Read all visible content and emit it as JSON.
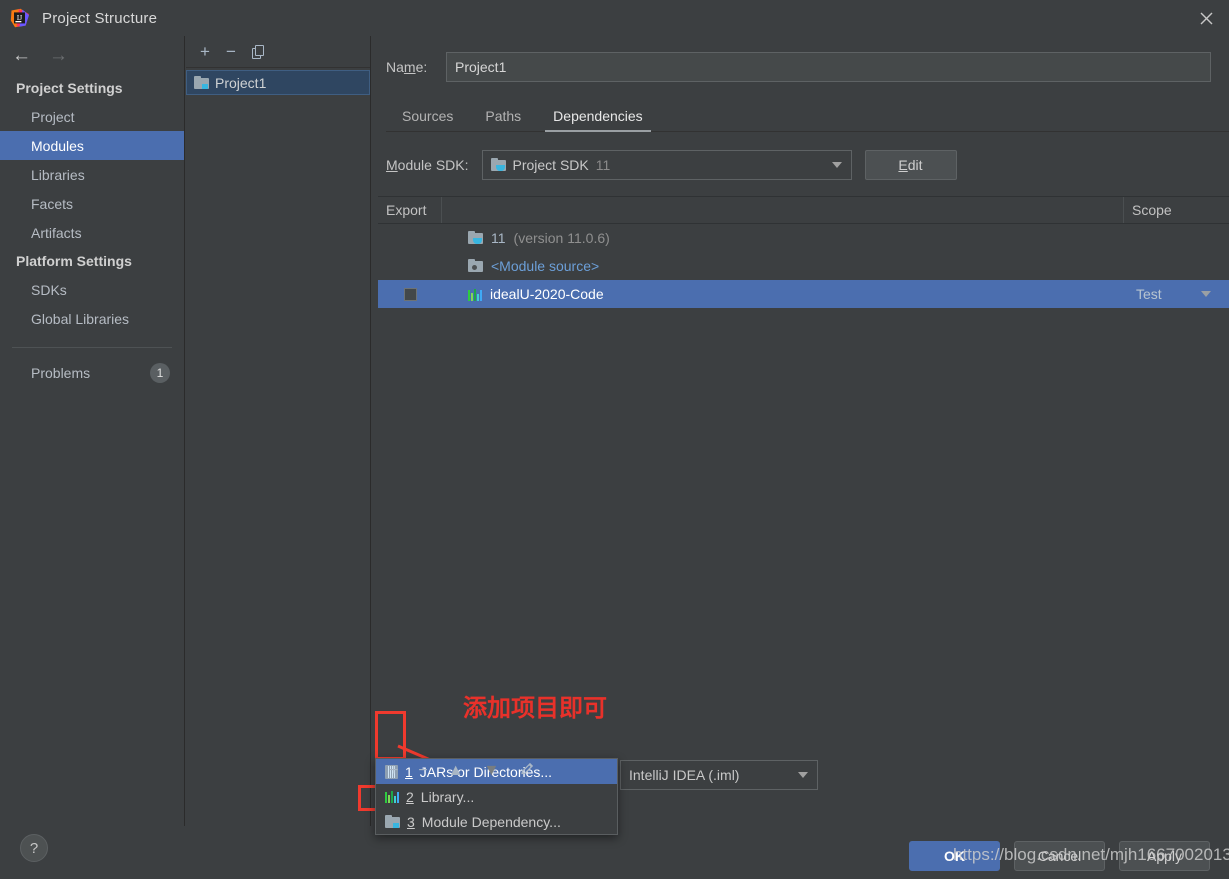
{
  "window": {
    "title": "Project Structure",
    "logo_icon": "intellij-idea-logo",
    "close_icon": "close-icon"
  },
  "sidebar": {
    "back_icon": "arrow-left-icon",
    "forward_icon": "arrow-right-icon",
    "groups": [
      {
        "title": "Project Settings",
        "items": [
          {
            "label": "Project",
            "selected": false
          },
          {
            "label": "Modules",
            "selected": true
          },
          {
            "label": "Libraries",
            "selected": false
          },
          {
            "label": "Facets",
            "selected": false
          },
          {
            "label": "Artifacts",
            "selected": false
          }
        ]
      },
      {
        "title": "Platform Settings",
        "items": [
          {
            "label": "SDKs",
            "selected": false
          },
          {
            "label": "Global Libraries",
            "selected": false
          }
        ]
      }
    ],
    "problems": {
      "label": "Problems",
      "count": "1"
    }
  },
  "module_list": {
    "toolbar": {
      "add_icon": "plus-icon",
      "remove_icon": "minus-icon",
      "copy_icon": "copy-icon"
    },
    "items": [
      {
        "label": "Project1",
        "icon": "module-folder-icon",
        "selected": true
      }
    ]
  },
  "main": {
    "name_field": {
      "label": "Name:",
      "label_mnemonic": "m",
      "value": "Project1"
    },
    "tabs": [
      {
        "label": "Sources",
        "active": false
      },
      {
        "label": "Paths",
        "active": false
      },
      {
        "label": "Dependencies",
        "active": true
      }
    ],
    "sdk": {
      "label": "Module SDK:",
      "label_mnemonic": "M",
      "value": "Project SDK",
      "version": "11",
      "icon": "java-sdk-folder-icon",
      "edit_button": "Edit",
      "edit_mnemonic": "E"
    },
    "dependencies_table": {
      "columns": [
        "Export",
        "",
        "Scope"
      ],
      "rows": [
        {
          "export_checkbox": false,
          "has_checkbox": false,
          "name": "11",
          "name_suffix": "(version 11.0.6)",
          "icon": "java-sdk-folder-icon",
          "scope": "",
          "selected": false
        },
        {
          "export_checkbox": false,
          "has_checkbox": false,
          "name": "<Module source>",
          "name_suffix": "",
          "icon": "module-source-folder-icon",
          "scope": "",
          "selected": false
        },
        {
          "export_checkbox": false,
          "has_checkbox": true,
          "name": "idealU-2020-Code",
          "name_suffix": "",
          "icon": "library-bars-icon",
          "scope": "Test",
          "selected": true
        }
      ]
    },
    "dep_toolbar": {
      "add_icon": "plus-icon",
      "remove_icon": "minus-icon",
      "move_up_icon": "arrow-up-icon",
      "move_down_icon": "arrow-down-icon",
      "edit_icon": "pencil-icon"
    },
    "iml_combo": {
      "value": "IntelliJ IDEA (.iml)"
    }
  },
  "popup_menu": {
    "items": [
      {
        "num": "1",
        "label": "JARs or Directories...",
        "icon": "jar-icon",
        "active": true
      },
      {
        "num": "2",
        "label": "Library...",
        "icon": "library-bars-icon",
        "active": false
      },
      {
        "num": "3",
        "label": "Module Dependency...",
        "icon": "module-folder-icon",
        "active": false
      }
    ]
  },
  "annotations": {
    "note_text": "添加项目即可",
    "note_color": "#e8312a",
    "highlight_color": "#f03a2e"
  },
  "footer": {
    "help_label": "?",
    "ok_label": "OK",
    "cancel_label": "Cancel",
    "apply_label": "Apply"
  },
  "watermark": {
    "text": "https://blog.csdn.net/mjh1667002013"
  }
}
